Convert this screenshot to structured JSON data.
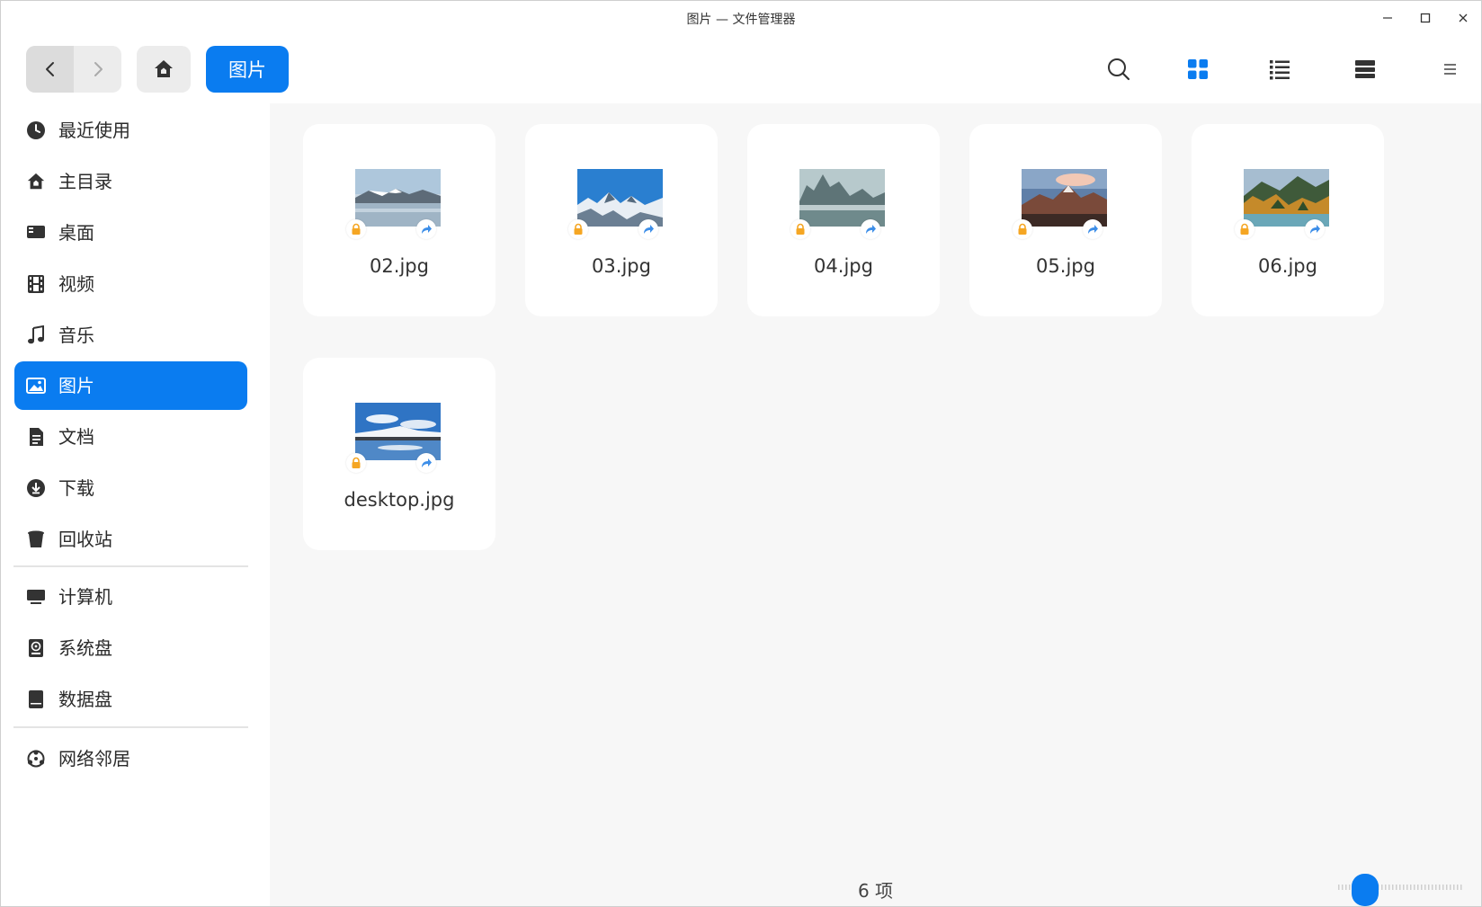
{
  "window": {
    "title": "图片 — 文件管理器"
  },
  "toolbar": {
    "breadcrumb": "图片",
    "icons": [
      "back-icon",
      "forward-icon",
      "home-icon",
      "search-icon",
      "icon-view-icon",
      "list-view-icon",
      "detail-view-icon",
      "menu-icon"
    ],
    "active_view": "icon-view",
    "accent": "#0a7cf0"
  },
  "sidebar": {
    "items": [
      {
        "label": "最近使用",
        "icon": "clock-icon"
      },
      {
        "label": "主目录",
        "icon": "home-icon"
      },
      {
        "label": "桌面",
        "icon": "desktop-icon"
      },
      {
        "label": "视频",
        "icon": "film-icon"
      },
      {
        "label": "音乐",
        "icon": "music-note-icon"
      },
      {
        "label": "图片",
        "icon": "image-icon",
        "active": true
      },
      {
        "label": "文档",
        "icon": "document-icon"
      },
      {
        "label": "下载",
        "icon": "download-icon"
      },
      {
        "label": "回收站",
        "icon": "trash-icon"
      }
    ],
    "devices": [
      {
        "label": "计算机",
        "icon": "computer-icon"
      },
      {
        "label": "系统盘",
        "icon": "system-disk-icon"
      },
      {
        "label": "数据盘",
        "icon": "data-disk-icon"
      }
    ],
    "network": [
      {
        "label": "网络邻居",
        "icon": "network-icon"
      }
    ]
  },
  "files": [
    {
      "name": "02.jpg",
      "thumb": "lake-mountains",
      "emblems": [
        "lock-icon",
        "share-icon"
      ]
    },
    {
      "name": "03.jpg",
      "thumb": "snow-peaks",
      "emblems": [
        "lock-icon",
        "share-icon"
      ]
    },
    {
      "name": "04.jpg",
      "thumb": "misty-cliffs",
      "emblems": [
        "lock-icon",
        "share-icon"
      ]
    },
    {
      "name": "05.jpg",
      "thumb": "sunset-peaks",
      "emblems": [
        "lock-icon",
        "share-icon"
      ]
    },
    {
      "name": "06.jpg",
      "thumb": "autumn-forest",
      "emblems": [
        "lock-icon",
        "share-icon"
      ]
    },
    {
      "name": "desktop.jpg",
      "thumb": "blue-lake",
      "emblems": [
        "lock-icon",
        "share-icon"
      ]
    }
  ],
  "status": {
    "count": "6 项"
  },
  "zoom": {
    "level": 0.22
  }
}
